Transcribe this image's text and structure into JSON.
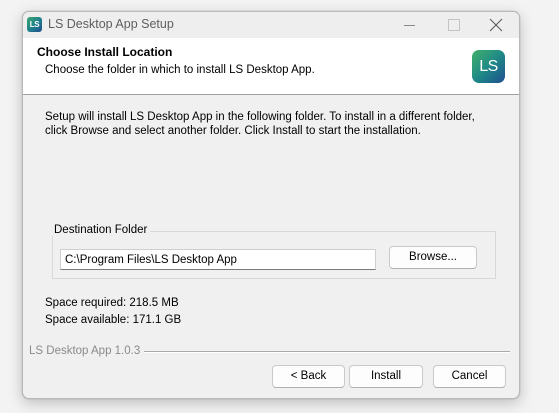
{
  "window": {
    "title": "LS Desktop App Setup",
    "icon_text": "LS"
  },
  "header": {
    "title": "Choose Install Location",
    "subtitle": "Choose the folder in which to install LS Desktop App.",
    "icon_text": "LS"
  },
  "body": {
    "description": "Setup will install LS Desktop App in the following folder. To install in a different folder, click Browse and select another folder. Click Install to start the installation.",
    "destination_label": "Destination Folder",
    "destination_path": "C:\\Program Files\\LS Desktop App",
    "browse_label": "Browse...",
    "space_required": "Space required: 218.5 MB",
    "space_available": "Space available: 171.1 GB"
  },
  "footer": {
    "brand": "LS Desktop App 1.0.3",
    "back_label": "< Back",
    "install_label": "Install",
    "cancel_label": "Cancel"
  },
  "colors": {
    "accent_green": "#3aa66b",
    "accent_blue": "#214a8c"
  }
}
